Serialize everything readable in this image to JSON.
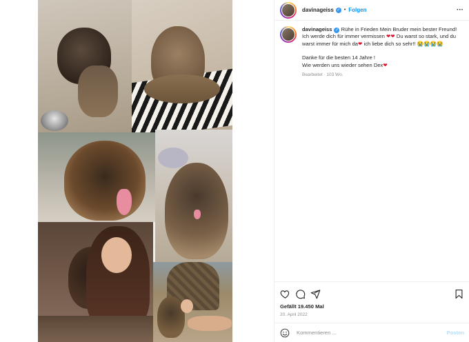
{
  "post": {
    "username": "davinageiss",
    "verified": true,
    "separator": "•",
    "follow_label": "Folgen",
    "more_label": "···"
  },
  "caption": {
    "username": "davinageiss",
    "line1": "Rühe in Frieden Mein Bruder mein bester Freund! Ich werde dich für immer vermissen",
    "hearts1": "❤❤",
    "line2": " Du warst so stark, und du warst immer für mich da",
    "heart2": "❤",
    "line3": " ich liebe dich so sehr!! ",
    "cry_emojis": "😭😭😭😭",
    "para2_line1": "Danke für die besten 14 Jahre !",
    "para2_line2": "Wie werden uns wieder sehen Dex",
    "heart3": "❤",
    "edited": "Bearbeitet · 103 Wo."
  },
  "stats": {
    "likes": "Gefällt 19.450 Mal",
    "date": "20. April 2022"
  },
  "comment": {
    "placeholder": "Kommentieren ...",
    "post_label": "Posten"
  },
  "colors": {
    "accent": "#0095f6",
    "verified": "#3897f0",
    "heart": "#e0102a",
    "muted": "#8e8e8e",
    "post_disabled": "#b2dffc"
  },
  "icons": [
    "heart-icon",
    "comment-icon",
    "share-icon",
    "bookmark-icon",
    "emoji-icon",
    "more-icon",
    "verified-icon"
  ]
}
